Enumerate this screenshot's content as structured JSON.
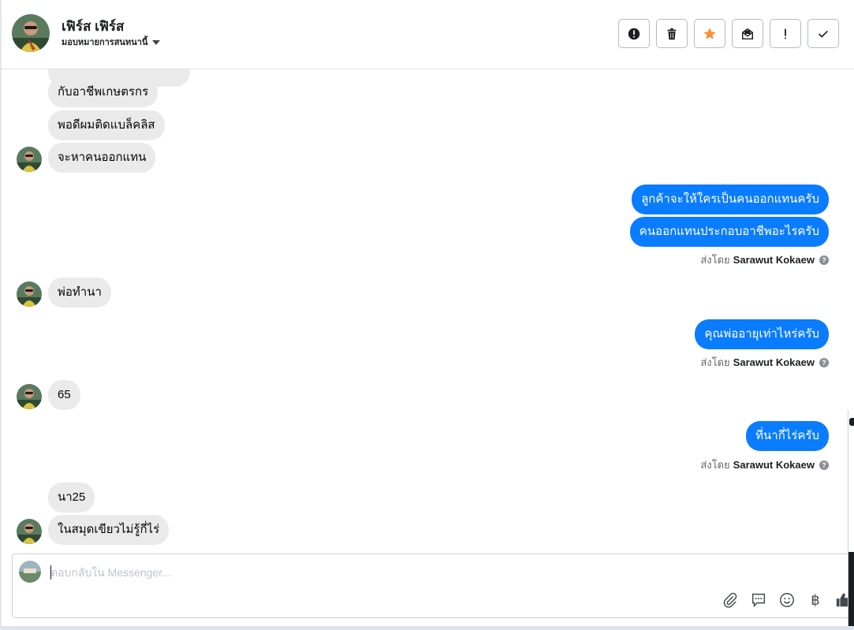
{
  "header": {
    "contact_name": "เฟิร์ส เฟิร์ส",
    "assign_label": "มอบหมายการสนทนานี้",
    "actions": [
      {
        "name": "report-spam-button",
        "icon": "alert-circle-icon"
      },
      {
        "name": "delete-button",
        "icon": "trash-icon"
      },
      {
        "name": "star-button",
        "icon": "star-icon"
      },
      {
        "name": "mark-unread-button",
        "icon": "envelope-open-icon"
      },
      {
        "name": "follow-up-button",
        "icon": "exclamation-icon"
      },
      {
        "name": "mark-done-button",
        "icon": "check-icon"
      }
    ],
    "star_color": "#f7923a"
  },
  "messages": {
    "in1": "กับอาชีพเกษตรกร",
    "in2": "พอดีผมติดแบล็คลิส",
    "in3": "จะหาคนออกแทน",
    "out1": "ลูกค้าจะให้ใครเป็นคนออกแทนครับ",
    "out2": "คนออกแทนประกอบอาชีพอะไรครับ",
    "in4": "พ่อทำนา",
    "out3": "คุณพ่ออายุเท่าไหร่ครับ",
    "in5": "65",
    "out4": "ที่นากี่ไร่ครับ",
    "in6": "นา25",
    "in7": "ในสมุดเขียวไม่รู้กี่ไร่"
  },
  "sent_by": {
    "prefix": "ส่งโดย",
    "name": "Sarawut Kokaew",
    "help": "?"
  },
  "composer": {
    "placeholder": "ตอบกลับใน Messenger...",
    "tools": [
      "paperclip-icon",
      "saved-reply-icon",
      "emoji-icon",
      "baht-icon",
      "thumbs-up-icon"
    ],
    "baht_symbol": "฿"
  },
  "colors": {
    "outgoing_bubble": "#0a7cff",
    "incoming_bubble": "#eaeaea"
  }
}
